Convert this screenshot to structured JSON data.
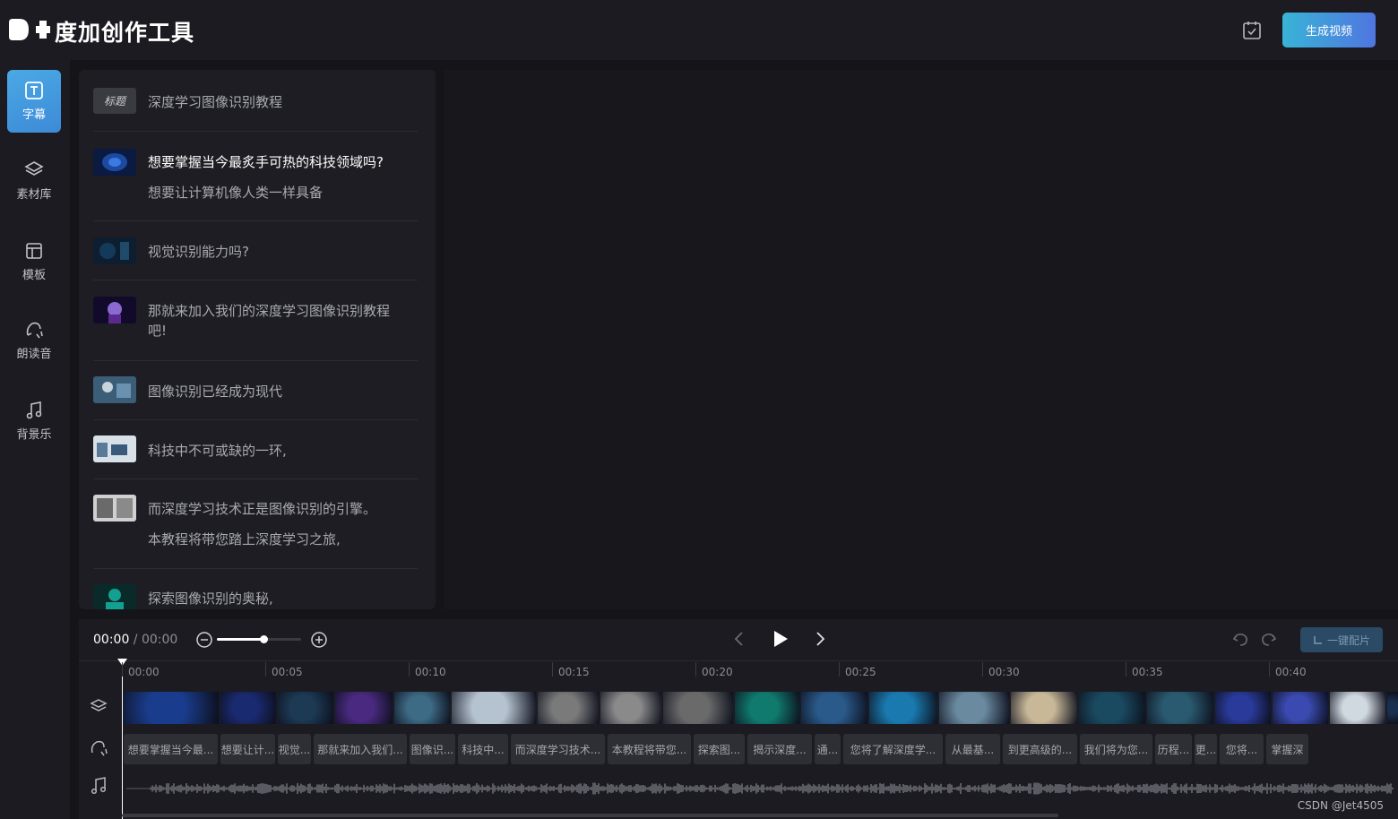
{
  "app": {
    "title": "度加创作工具"
  },
  "header": {
    "generate_label": "生成视频",
    "check_icon": "checklist-icon"
  },
  "nav": {
    "items": [
      {
        "label": "字幕",
        "icon": "text-icon",
        "active": true
      },
      {
        "label": "素材库",
        "icon": "layers-icon",
        "active": false
      },
      {
        "label": "模板",
        "icon": "template-icon",
        "active": false
      },
      {
        "label": "朗读音",
        "icon": "voice-icon",
        "active": false
      },
      {
        "label": "背景乐",
        "icon": "music-icon",
        "active": false
      }
    ]
  },
  "script": {
    "title_tag": "标题",
    "title": "深度学习图像识别教程",
    "rows": [
      {
        "lines": [
          "想要掌握当今最炙手可热的科技领域吗?",
          "想要让计算机像人类一样具备"
        ],
        "thumb_color": "#1d4aa0"
      },
      {
        "lines": [
          "视觉识别能力吗?"
        ],
        "thumb_color": "#143a5a"
      },
      {
        "lines": [
          "那就来加入我们的深度学习图像识别教程",
          "吧!"
        ],
        "thumb_color": "#5a2a90"
      },
      {
        "lines": [
          "图像识别已经成为现代"
        ],
        "thumb_color": "#3c5d78"
      },
      {
        "lines": [
          "科技中不可或缺的一环,"
        ],
        "thumb_color": "#8aa4c0"
      },
      {
        "lines": [
          "而深度学习技术正是图像识别的引擎。",
          "本教程将带您踏上深度学习之旅,"
        ],
        "thumb_color": "#8a8a8a"
      },
      {
        "lines": [
          "探索图像识别的奥秘,"
        ],
        "thumb_color": "#14a090"
      }
    ]
  },
  "timeline": {
    "current_time": "00:00",
    "separator": " / ",
    "total_time": "00:00",
    "zoom_level": 0.55,
    "auto_button_label": "一键配片",
    "ticks": [
      "00:00",
      "00:05",
      "00:10",
      "00:15",
      "00:20",
      "00:25",
      "00:30",
      "00:35",
      "00:40"
    ],
    "video_clips": [
      "#1a3c8c",
      "#1a2a70",
      "#1d3a55",
      "#4a2a80",
      "#3d6a85",
      "#b5c2d0",
      "#7a7a7a",
      "#8a8a8a",
      "#6a6a6a",
      "#107a6e",
      "#2a5a8a",
      "#1a7ab0",
      "#6a8aa0",
      "#c8b898",
      "#1a4a60",
      "#2a5a70",
      "#2a3a9a",
      "#3a4ab0",
      "#d0d8e0",
      "#1a3050"
    ],
    "subtitle_clips": [
      "想要掌握当今最...",
      "想要让计...",
      "视觉...",
      "那就来加入我们...",
      "图像识...",
      "科技中...",
      "而深度学习技术...",
      "本教程将带您...",
      "探索图...",
      "揭示深度...",
      "通...",
      "您将了解深度学...",
      "从最基...",
      "到更高级的...",
      "我们将为您...",
      "历程...",
      "更...",
      "您将...",
      "掌握深"
    ]
  },
  "watermark": "CSDN @Jet4505"
}
